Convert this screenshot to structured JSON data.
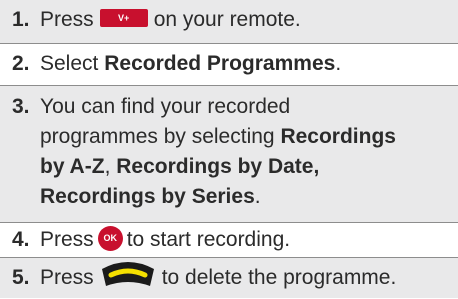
{
  "steps": [
    {
      "num": "1.",
      "pre": "Press",
      "post": "on your remote.",
      "button": "V+"
    },
    {
      "num": "2.",
      "pre": "Select",
      "bold": "Recorded Programmes",
      "post": "."
    },
    {
      "num": "3.",
      "line1": "You can find your recorded",
      "line2_pre": "programmes by selecting",
      "line2_bold": "Recordings",
      "line3_bold1": "by A-Z",
      "line3_sep": ",",
      "line3_bold2": "Recordings by Date,",
      "line4_bold": "Recordings by Series",
      "line4_post": "."
    },
    {
      "num": "4.",
      "pre": "Press",
      "post": "to start recording.",
      "button": "OK"
    },
    {
      "num": "5.",
      "pre": "Press",
      "post": "to delete the programme.",
      "button": "yellow-button-icon"
    }
  ],
  "colors": {
    "accent_red": "#c8102e",
    "shade": "#e9e9ea",
    "yellow": "#f5e000"
  }
}
